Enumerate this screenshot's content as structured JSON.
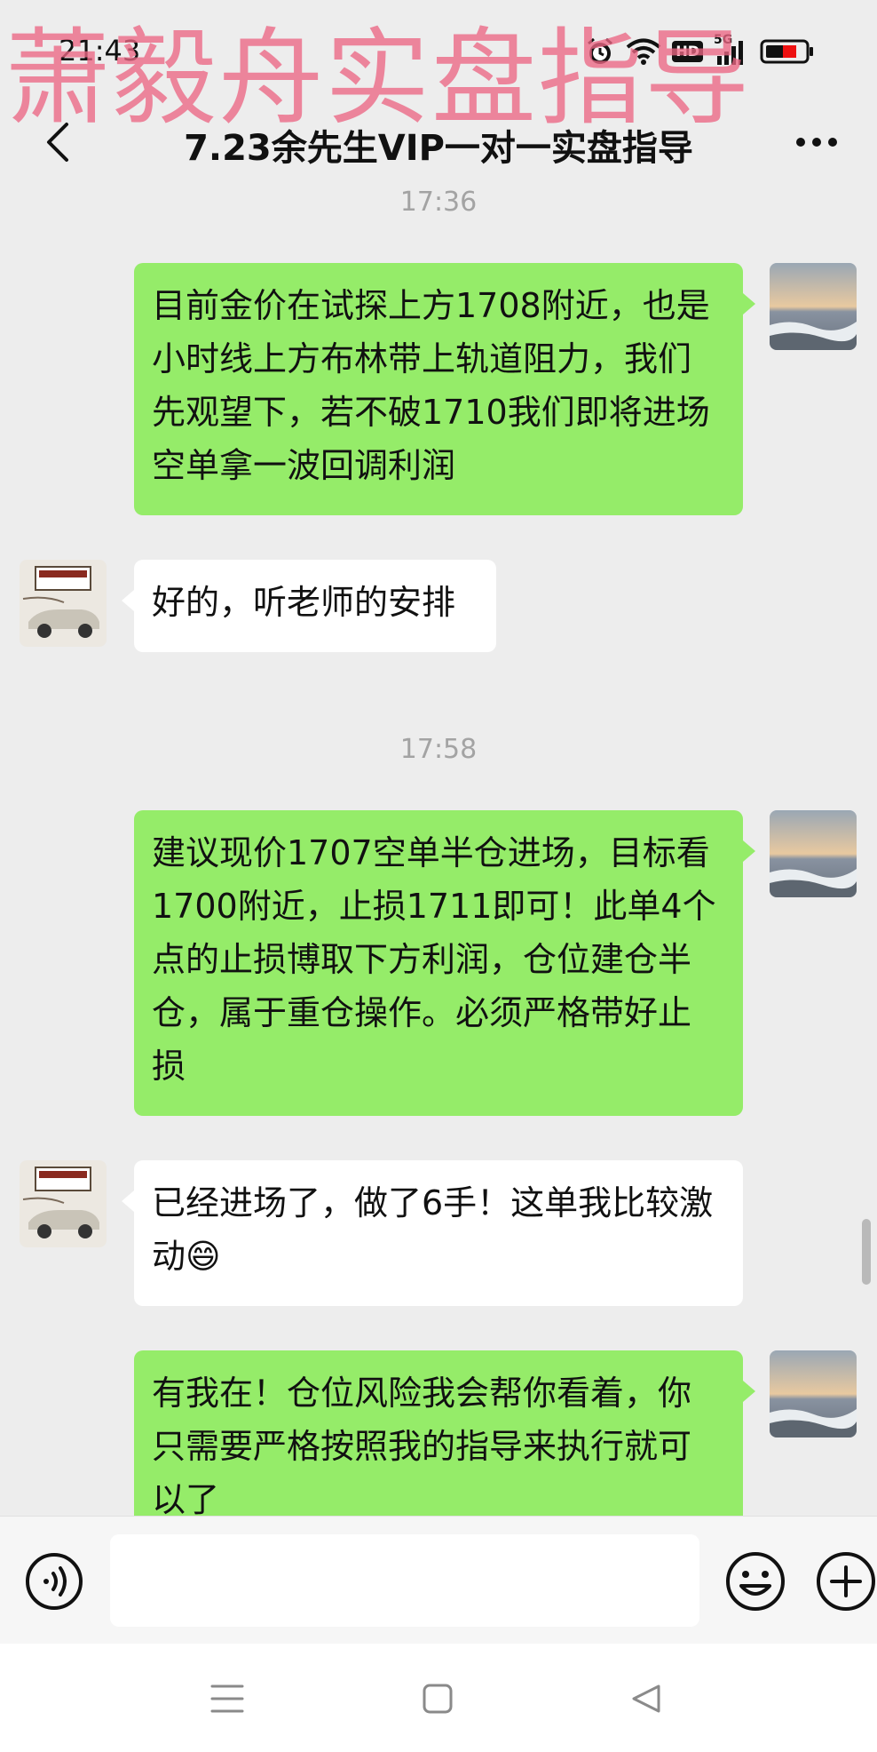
{
  "status_bar": {
    "time": "21:43",
    "hd_label": "HD",
    "network_label": "5G",
    "icons": [
      "alarm-icon",
      "wifi-icon",
      "hd-icon",
      "signal-icon",
      "battery-icon"
    ]
  },
  "watermark": {
    "text": "萧毅舟实盘指导"
  },
  "header": {
    "title": "7.23余先生VIP一对一实盘指导"
  },
  "messages": [
    {
      "type": "time",
      "text": "17:36"
    },
    {
      "type": "bubble",
      "side": "outgoing",
      "text": "目前金价在试探上方1708附近，也是小时线上方布林带上轨道阻力，我们先观望下，若不破1710我们即将进场空单拿一波回调利润"
    },
    {
      "type": "bubble",
      "side": "incoming",
      "text": "好的，听老师的安排"
    },
    {
      "type": "time",
      "text": "17:58"
    },
    {
      "type": "bubble",
      "side": "outgoing",
      "text": "建议现价1707空单半仓进场，目标看1700附近，止损1711即可！此单4个点的止损博取下方利润，仓位建仓半仓，属于重仓操作。必须严格带好止损"
    },
    {
      "type": "bubble",
      "side": "incoming",
      "text": "已经进场了，做了6手！这单我比较激动😄"
    },
    {
      "type": "bubble",
      "side": "outgoing",
      "text": "有我在！仓位风险我会帮你看着，你只需要严格按照我的指导来执行就可以了"
    }
  ],
  "input": {
    "value": "",
    "placeholder": ""
  },
  "colors": {
    "background": "#ededed",
    "outgoing_bubble": "#95ec69",
    "incoming_bubble": "#ffffff",
    "watermark": "#ec6684"
  }
}
